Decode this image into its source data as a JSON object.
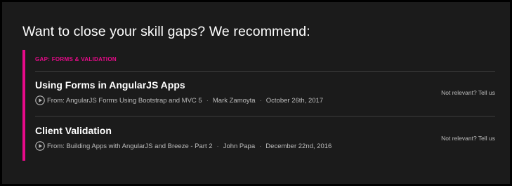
{
  "heading": "Want to close your skill gaps? We recommend:",
  "gap": {
    "label": "GAP: FORMS & VALIDATION",
    "accent_color": "#e80a89"
  },
  "recommendations": [
    {
      "title": "Using Forms in AngularJS Apps",
      "play_icon": "play-circle-icon",
      "from": "From: AngularJS Forms Using Bootstrap and MVC 5",
      "separator": "·",
      "author": "Mark Zamoyta",
      "date": "October 26th, 2017",
      "feedback": "Not relevant? Tell us"
    },
    {
      "title": "Client Validation",
      "play_icon": "play-circle-icon",
      "from": "From: Building Apps with AngularJS and Breeze - Part 2",
      "separator": "·",
      "author": "John Papa",
      "date": "December 22nd, 2016",
      "feedback": "Not relevant? Tell us"
    }
  ]
}
